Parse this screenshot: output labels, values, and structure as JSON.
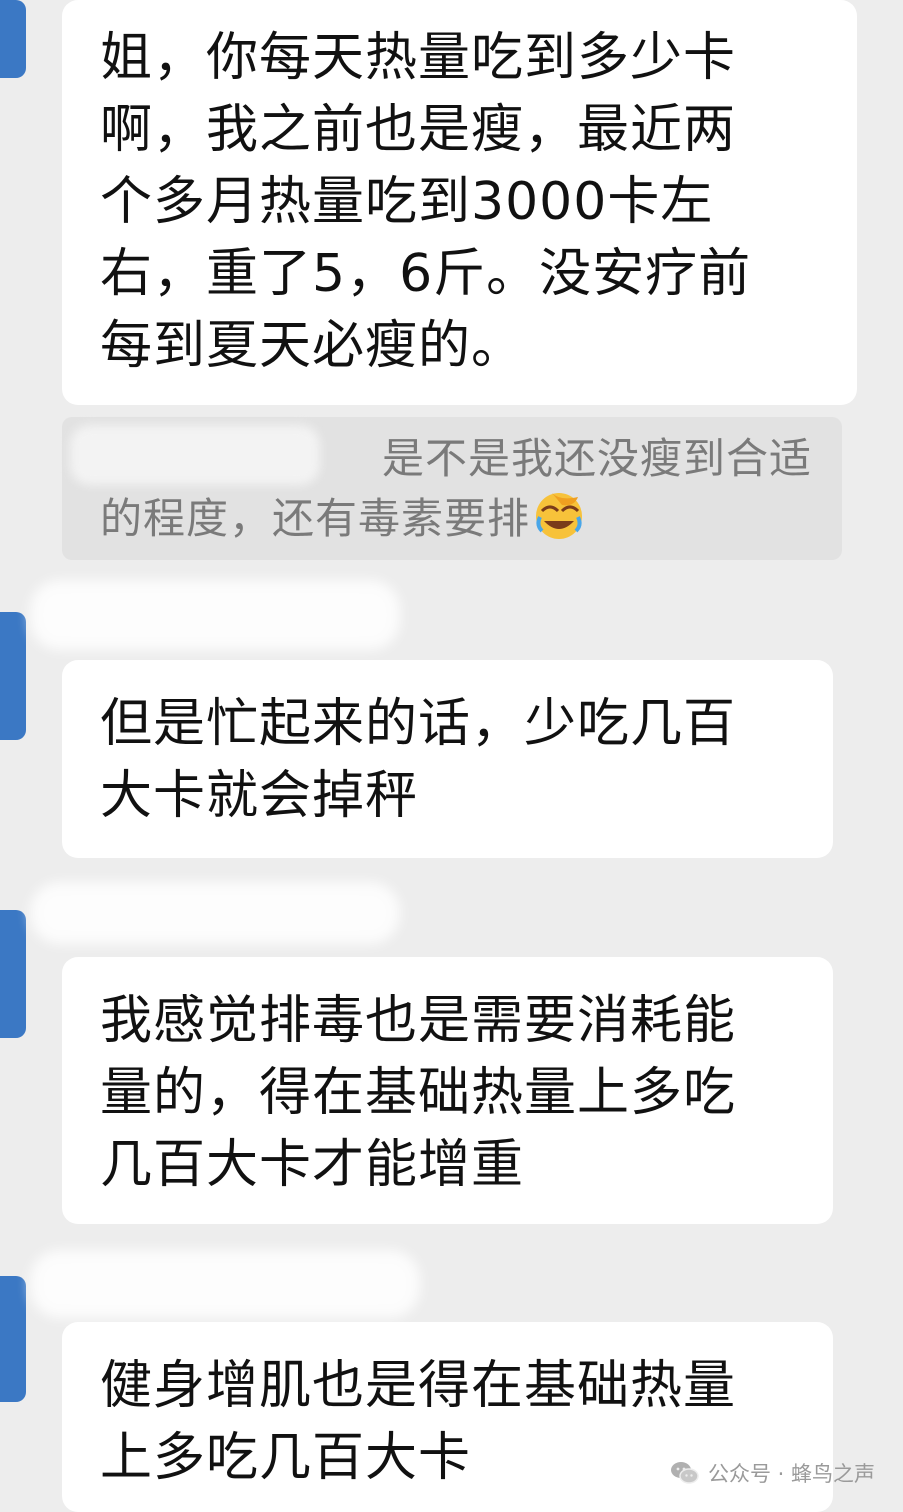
{
  "messages": [
    {
      "lines": [
        "姐，你每天热量吃到多少卡",
        "啊，我之前也是瘦，最近两",
        "个多月热量吃到3000卡左",
        "右，重了5，6斤。没安疗前",
        "每到夏天必瘦的。"
      ]
    },
    {
      "lines": [
        "但是忙起来的话，少吃几百",
        "大卡就会掉秤"
      ]
    },
    {
      "lines": [
        "我感觉排毒也是需要消耗能",
        "量的，得在基础热量上多吃",
        "几百大卡才能增重"
      ]
    },
    {
      "lines": [
        "健身增肌也是得在基础热量",
        "上多吃几百大卡"
      ]
    }
  ],
  "quote": {
    "line1": "是不是我还没瘦到合适",
    "line2": "的程度，还有毒素要排",
    "emoji": "facepalm-laugh-emoji"
  },
  "watermark": {
    "text": "公众号 · 蜂鸟之声",
    "icon": "wechat-icon"
  },
  "colors": {
    "background": "#ededed",
    "bubble": "#ffffff",
    "quote_bg": "#e2e2e2",
    "avatar": "#3b78c4"
  }
}
